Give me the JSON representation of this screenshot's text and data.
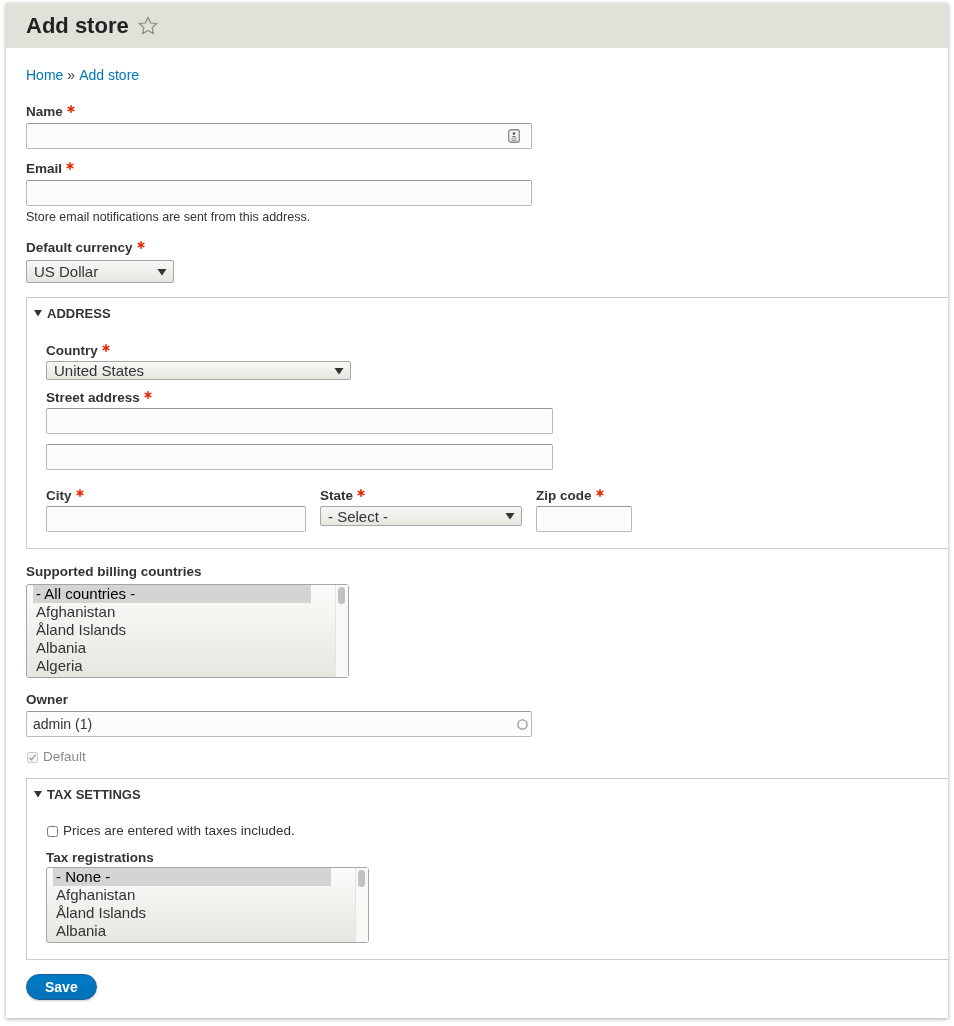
{
  "header": {
    "title": "Add store",
    "starred": false
  },
  "breadcrumb": {
    "links": [
      "Home",
      "Add store"
    ],
    "separator": "»"
  },
  "fields": [
    {
      "kind": "autofill",
      "label": "Name",
      "required": true
    },
    {
      "kind": "email",
      "label": "Email",
      "required": true,
      "description": "Store email notifications are sent from this address."
    },
    {
      "kind": "select",
      "label": "Default currency",
      "required": true,
      "value": "US Dollar"
    },
    {
      "kind": "fieldset",
      "legend": "ADDRESS",
      "expanded": true,
      "fields": [
        {
          "kind": "select",
          "label": "Country",
          "required": true,
          "value": "United States"
        },
        {
          "kind": "text",
          "label": "Street address",
          "required": true
        },
        {
          "kind": "text"
        },
        {
          "kind": "row",
          "fields": [
            {
              "kind": "text",
              "label": "City",
              "required": true
            },
            {
              "kind": "select",
              "label": "State",
              "required": true,
              "value": "- Select -"
            },
            {
              "kind": "text",
              "label": "Zip code",
              "required": true
            }
          ]
        }
      ]
    },
    {
      "kind": "multiselect",
      "label": "Supported billing countries",
      "required": false,
      "options": [
        {
          "label": "- All countries -",
          "selected": true
        },
        {
          "label": "Afghanistan",
          "selected": false
        },
        {
          "label": "Åland Islands",
          "selected": false
        },
        {
          "label": "Albania",
          "selected": false
        },
        {
          "label": "Algeria",
          "selected": false
        }
      ]
    },
    {
      "kind": "autocomplete",
      "label": "Owner",
      "required": false,
      "value": "admin (1)"
    },
    {
      "kind": "checkbox",
      "label": "Default",
      "checked": true,
      "disabled": true
    },
    {
      "kind": "fieldset",
      "legend": "TAX SETTINGS",
      "expanded": true,
      "fields": [
        {
          "kind": "checkbox",
          "label": "Prices are entered with taxes included.",
          "checked": false,
          "disabled": false
        },
        {
          "kind": "multiselect",
          "label": "Tax registrations",
          "required": false,
          "options": [
            {
              "label": "- None -",
              "selected": true
            },
            {
              "label": "Afghanistan",
              "selected": false
            },
            {
              "label": "Åland Islands",
              "selected": false
            },
            {
              "label": "Albania",
              "selected": false
            }
          ]
        }
      ]
    }
  ],
  "actions": [
    {
      "label": "Save",
      "primary": true
    }
  ]
}
